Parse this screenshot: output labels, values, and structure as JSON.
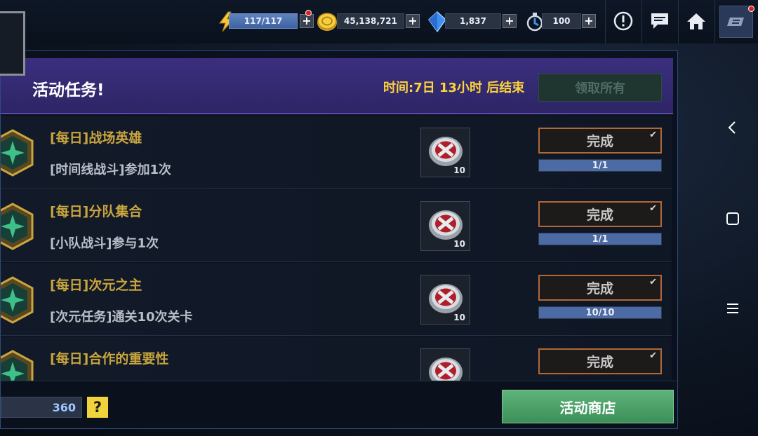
{
  "topbar": {
    "energy": "117/117",
    "gold": "45,138,721",
    "crystals": "1,837",
    "tokens": "100",
    "plus": "+"
  },
  "header": {
    "title": "活动任务!",
    "time_remaining": "时间:7日 13小时 后结束",
    "claim_all": "领取所有"
  },
  "tasks": [
    {
      "title": "[每日]战场英雄",
      "desc": "[时间线战斗]参加1次",
      "reward_count": "10",
      "button": "完成",
      "progress": "1/1",
      "fill": 1.0
    },
    {
      "title": "[每日]分队集合",
      "desc": "[小队战斗]参与1次",
      "reward_count": "10",
      "button": "完成",
      "progress": "1/1",
      "fill": 1.0
    },
    {
      "title": "[每日]次元之主",
      "desc": "[次元任务]通关10次关卡",
      "reward_count": "10",
      "button": "完成",
      "progress": "10/10",
      "fill": 1.0
    },
    {
      "title": "[每日]合作的重要性",
      "desc": "",
      "reward_count": "",
      "button": "完成",
      "progress": "",
      "fill": 1.0
    }
  ],
  "footer": {
    "points": "360",
    "help": "?",
    "shop": "活动商店"
  },
  "colors": {
    "header_bg": "#3b2f7e",
    "time_text": "#ffd43a",
    "task_title": "#c9a53e",
    "done_border": "#b0683a",
    "progress_fill": "#4c6aa4",
    "shop_green": "#4fa46a"
  },
  "icons": {
    "energy": "lightning-icon",
    "gold": "gold-coin-icon",
    "crystals": "blue-crystal-icon",
    "tokens": "stopwatch-icon",
    "alert": "alert-icon",
    "chat": "chat-icon",
    "home": "home-icon",
    "menu": "menu-icon"
  }
}
